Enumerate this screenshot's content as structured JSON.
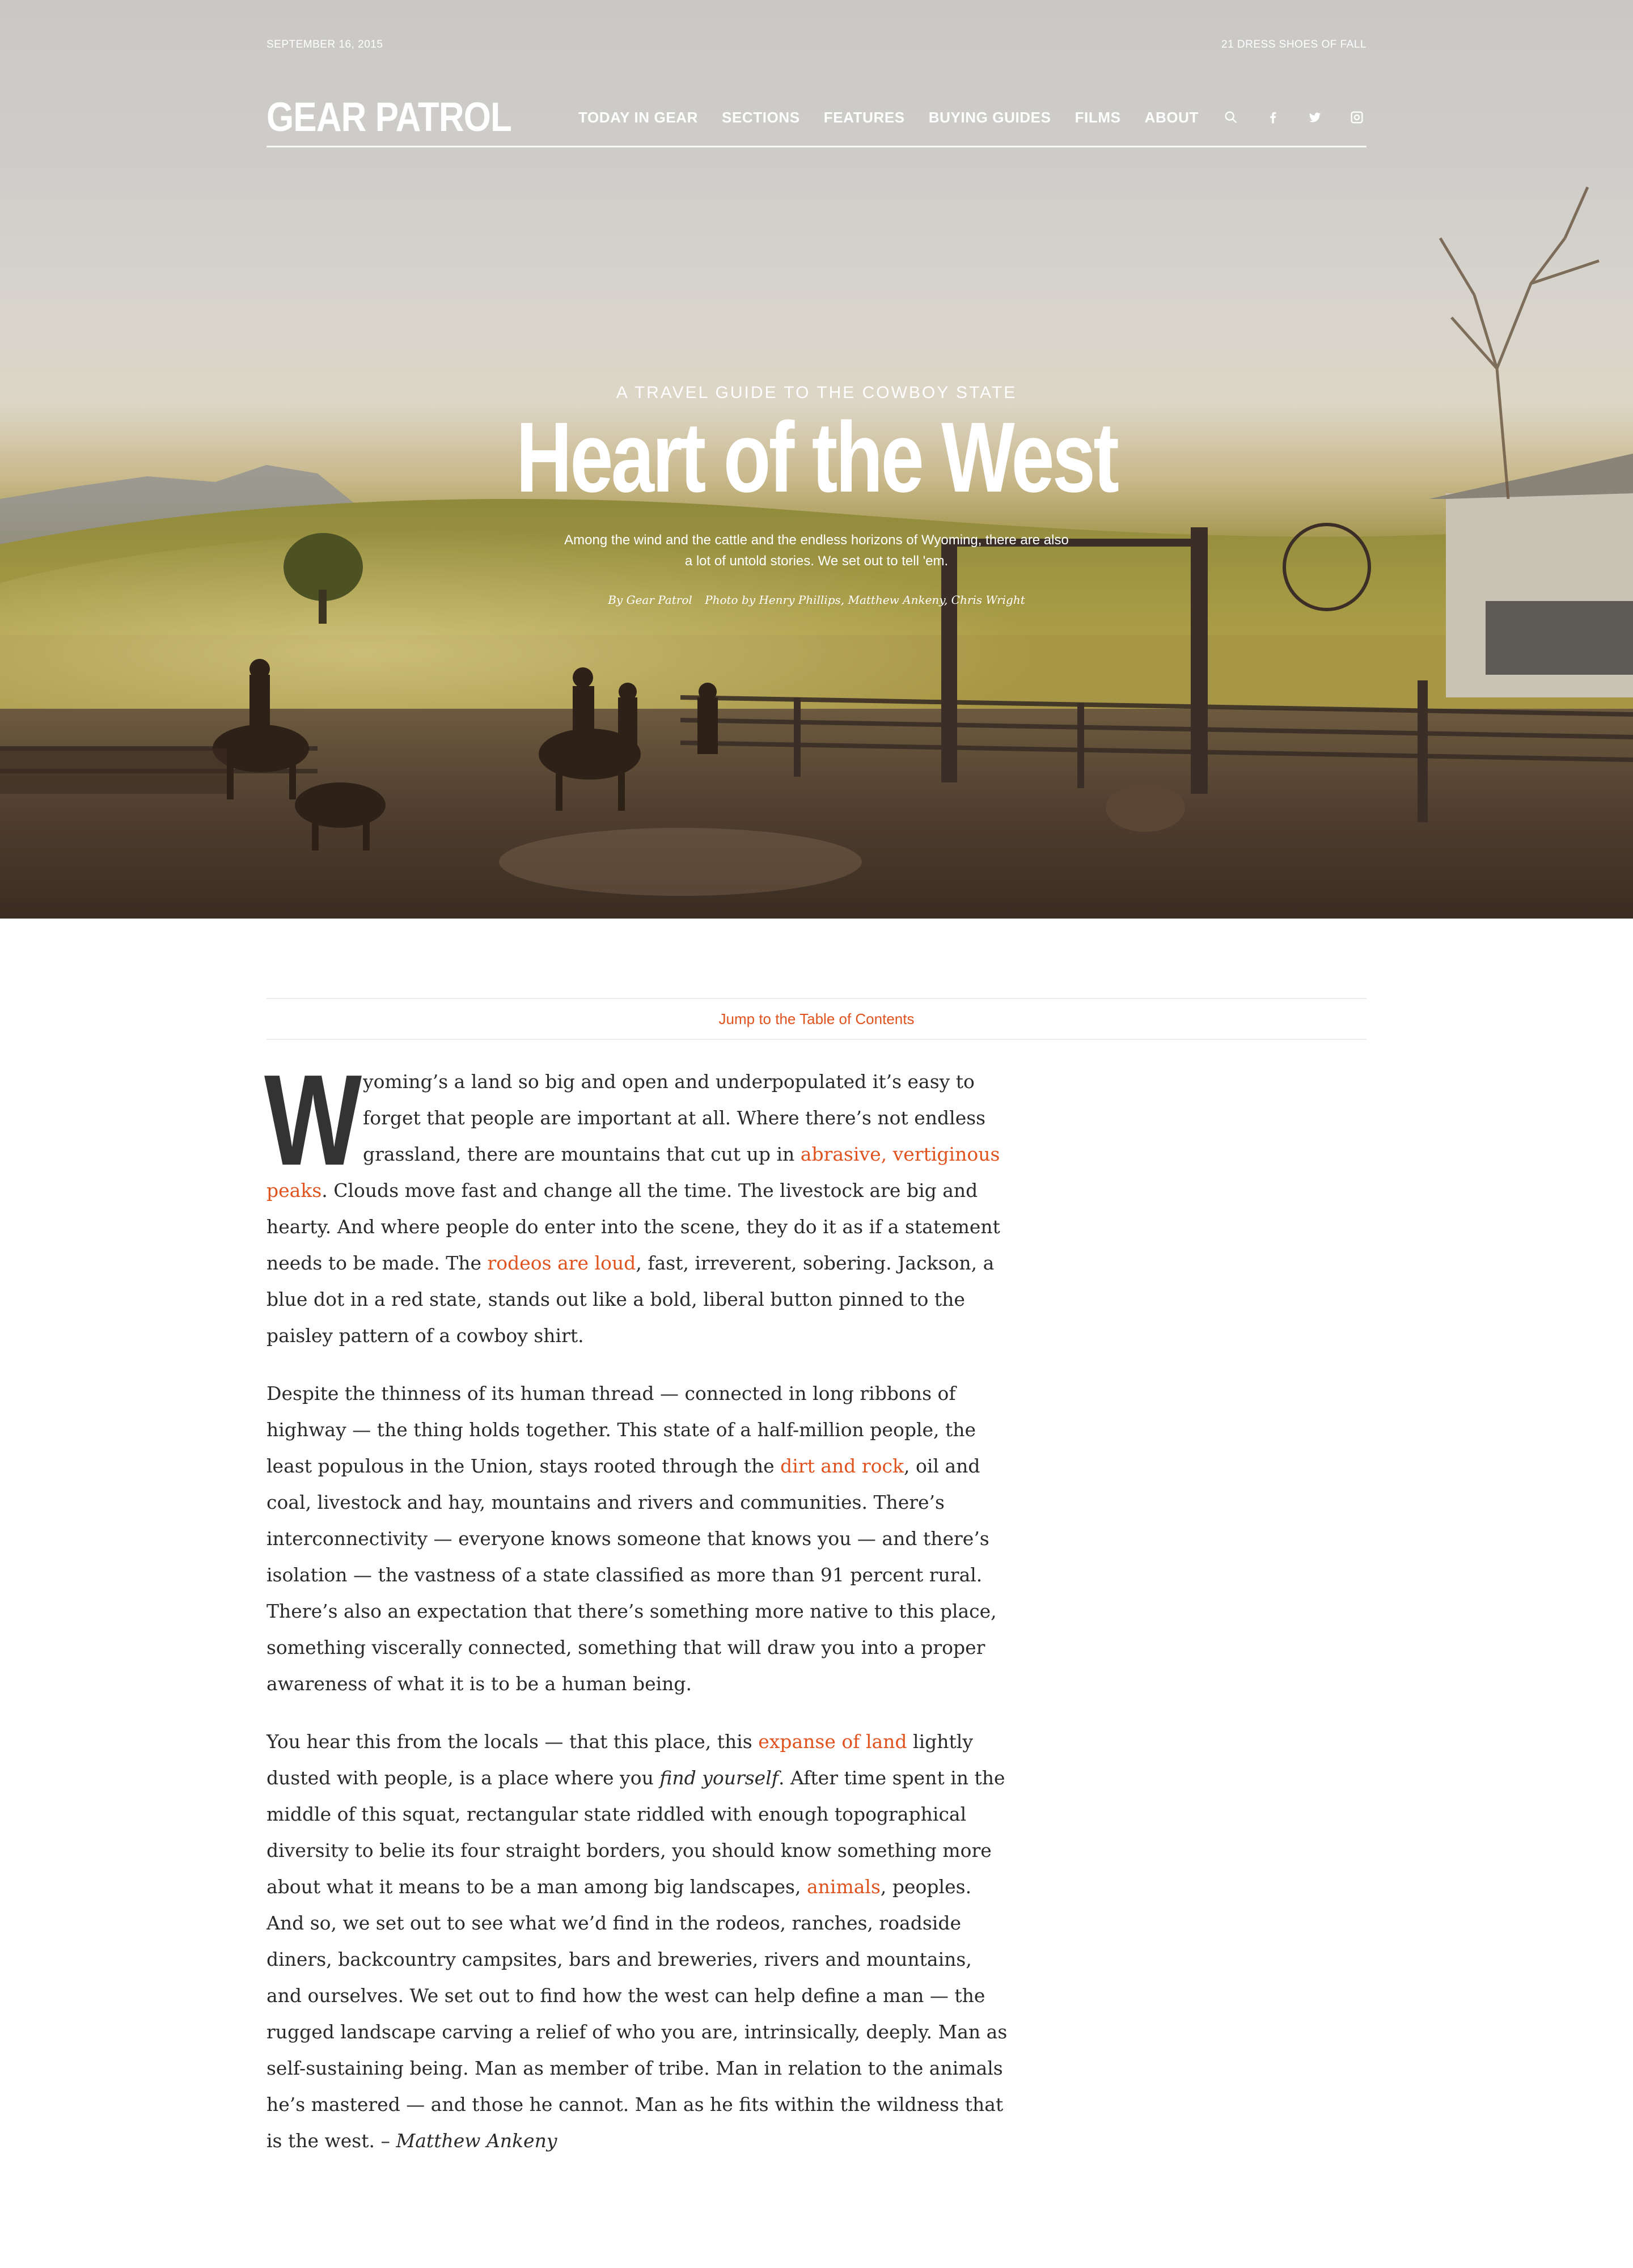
{
  "header": {
    "date": "SEPTEMBER 16, 2015",
    "promo": "21 DRESS SHOES OF FALL",
    "logo": "GEAR PATROL",
    "nav": [
      "TODAY IN GEAR",
      "SECTIONS",
      "FEATURES",
      "BUYING GUIDES",
      "FILMS",
      "ABOUT"
    ],
    "icons": [
      "search-icon",
      "facebook-icon",
      "twitter-icon",
      "instagram-icon"
    ]
  },
  "hero": {
    "kicker": "A TRAVEL GUIDE TO THE COWBOY STATE",
    "title": "Heart of the West",
    "dek": "Among the wind and the cattle and the endless horizons of Wyoming, there are also a lot of untold stories. We set out to tell 'em.",
    "byline_author": "By Gear Patrol",
    "byline_photo": "Photo by Henry Phillips, Matthew Ankeny, Chris Wright"
  },
  "jump_link": "Jump to the Table of Contents",
  "article": {
    "dropcap": "W",
    "p1": {
      "a": "yoming’s a land so big and open and underpopulated it’s easy to forget that people are important at all. Where there’s not endless grassland, there are mountains that cut up in ",
      "link1": "abrasive, vertiginous peaks",
      "b": ". Clouds move fast and change all the time. The livestock are big and hearty. And where people do enter into the scene, they do it as if a statement needs to be made. The ",
      "link2": "rodeos are loud",
      "c": ", fast, irreverent, sobering. Jackson, a blue dot in a red state, stands out like a bold, liberal button pinned to the paisley pattern of a cowboy shirt."
    },
    "p2": {
      "a": "Despite the thinness of its human thread — connected in long ribbons of highway — the thing holds together. This state of a half-million people, the least populous in the Union, stays rooted through the ",
      "link1": "dirt and rock",
      "b": ", oil and coal, livestock and hay, mountains and rivers and communities. There’s interconnectivity — everyone knows someone that knows you — and there’s isolation — the vastness of a state classified as more than 91 percent rural. There’s also an expectation that there’s something more native to this place, something viscerally connected, something that will draw you into a proper awareness of what it is to be a human being."
    },
    "p3": {
      "a": "You hear this from the locals — that this place, this ",
      "link1": "expanse of land",
      "b": " lightly dusted with people, is a place where you ",
      "em1": "find yourself",
      "c": ". After time spent in the middle of this squat, rectangular state riddled with enough topographical diversity to belie its four straight borders, you should know something more about what it means to be a man among big landscapes, ",
      "link2": "animals",
      "d": ", peoples. And so, we set out to see what we’d find in the rodeos, ranches, roadside diners, backcountry campsites, bars and breweries, rivers and mountains, and ourselves. We set out to find how the west can help define a man — the rugged landscape carving a relief of who you are, intrinsically, deeply. Man as self-sustaining being. Man as member of tribe. Man in relation to the animals he’s mastered — and those he cannot. Man as he fits within the wildness that is the west. – ",
      "em2": "Matthew Ankeny"
    }
  },
  "colors": {
    "accent": "#e0521e",
    "text": "#2a2a2a",
    "rule": "#ececec"
  }
}
